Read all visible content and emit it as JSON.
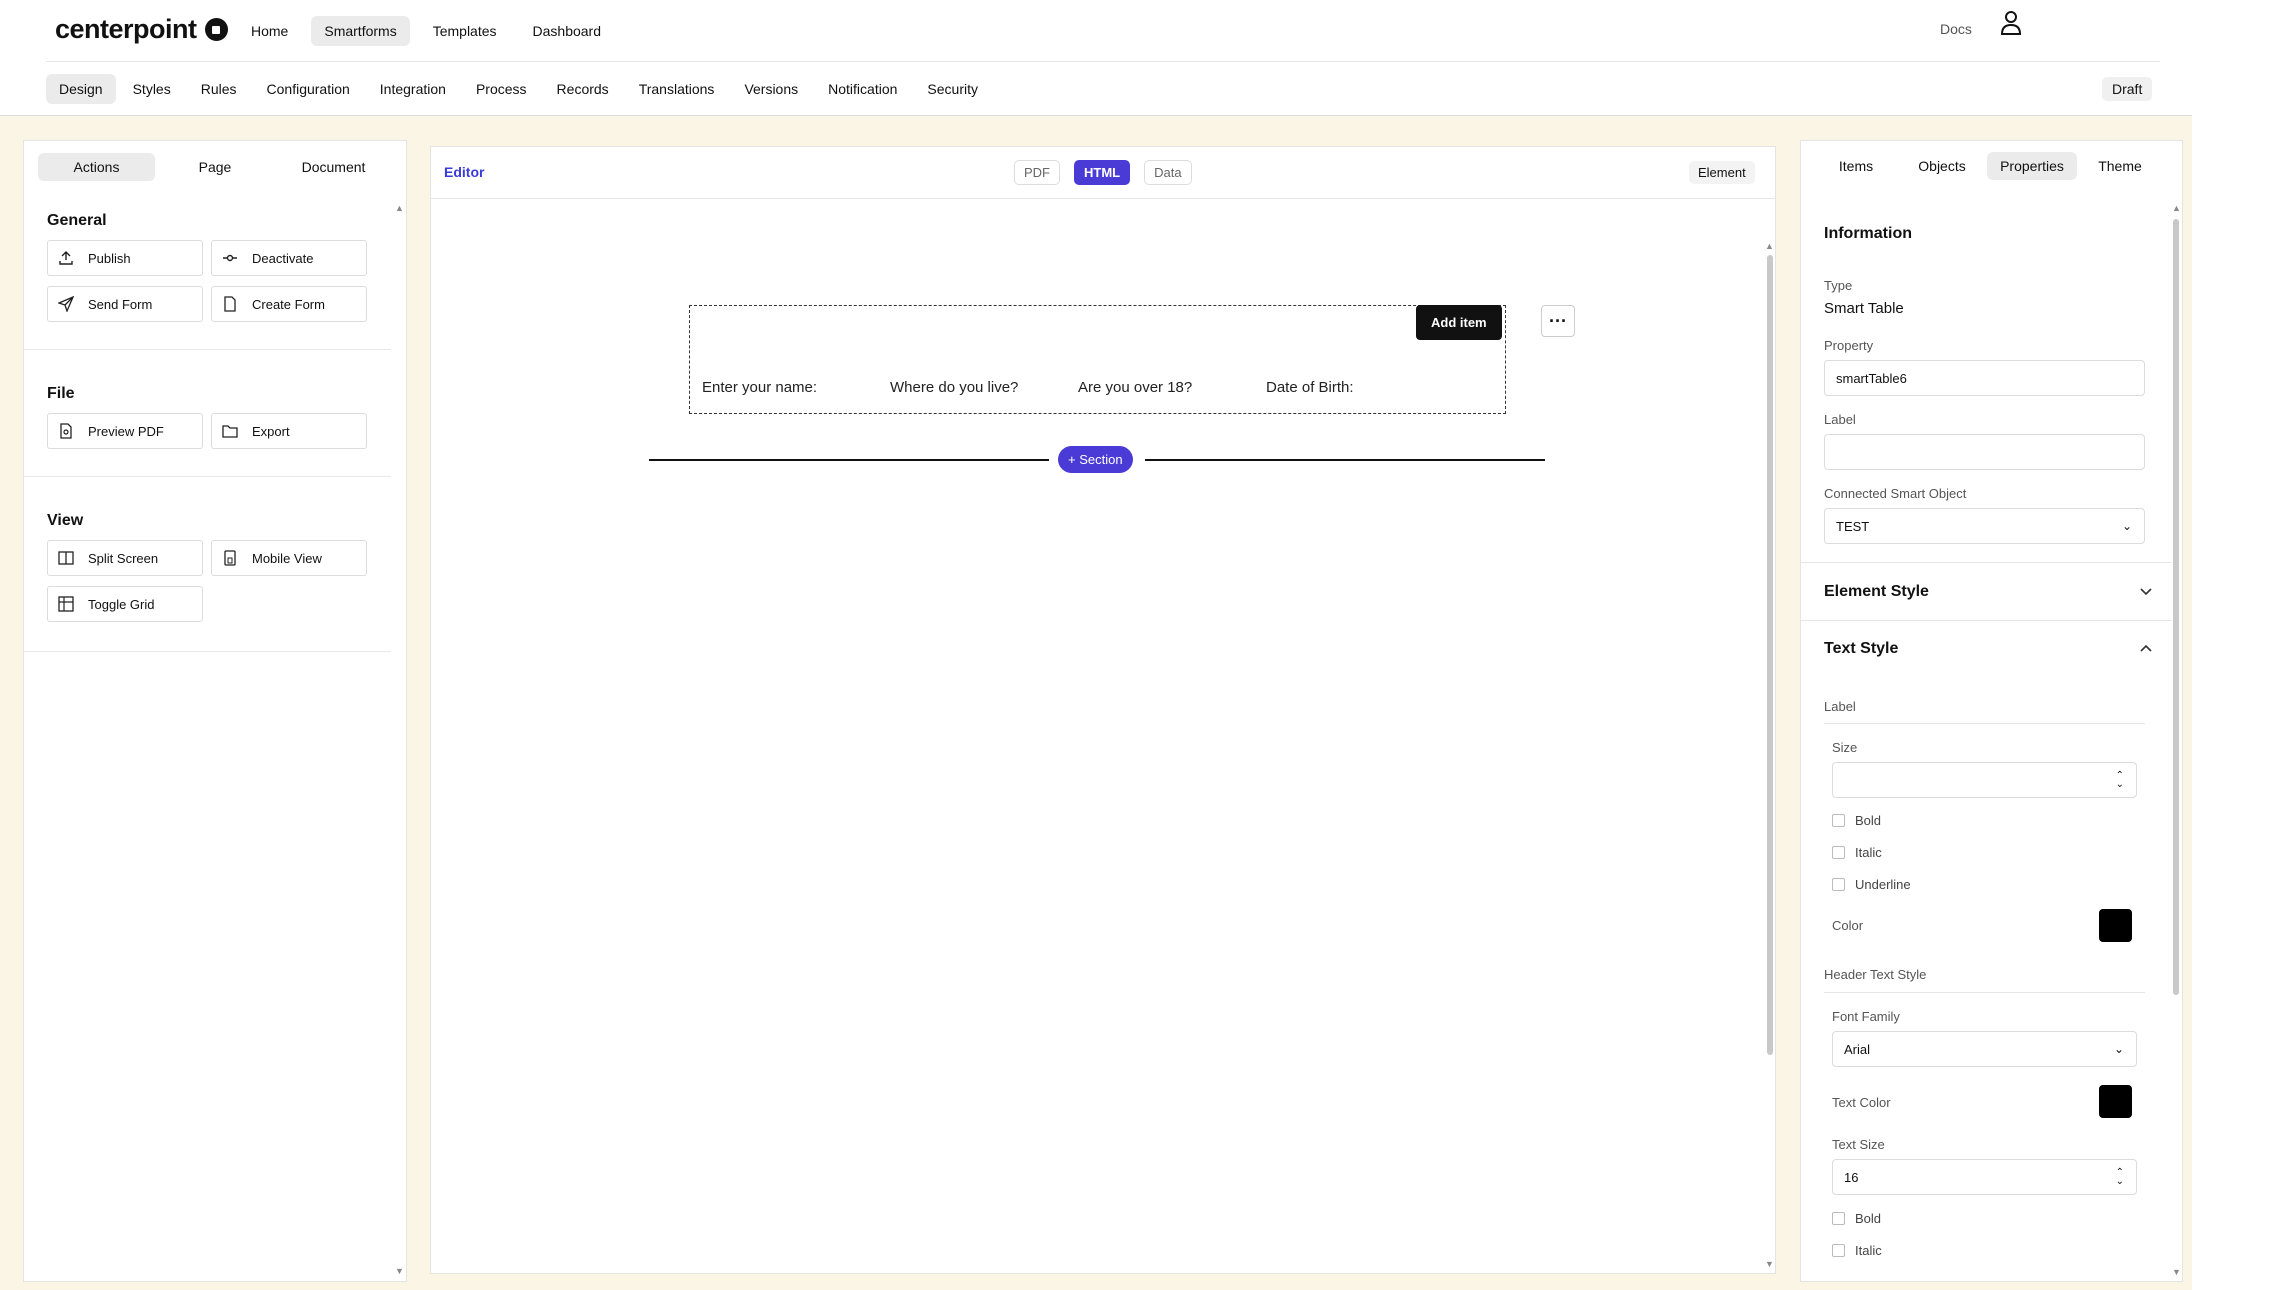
{
  "brand": "centerpoint",
  "mainnav": [
    "Home",
    "Smartforms",
    "Templates",
    "Dashboard"
  ],
  "docs": "Docs",
  "subnav": [
    "Design",
    "Styles",
    "Rules",
    "Configuration",
    "Integration",
    "Process",
    "Records",
    "Translations",
    "Versions",
    "Notification",
    "Security"
  ],
  "status": "Draft",
  "left": {
    "tabs": [
      "Actions",
      "Page",
      "Document"
    ],
    "general": {
      "title": "General",
      "buttons": [
        "Publish",
        "Deactivate",
        "Send Form",
        "Create Form"
      ]
    },
    "file": {
      "title": "File",
      "buttons": [
        "Preview PDF",
        "Export"
      ]
    },
    "view": {
      "title": "View",
      "buttons": [
        "Split Screen",
        "Mobile View",
        "Toggle Grid"
      ]
    }
  },
  "editor": {
    "label": "Editor",
    "modes": [
      "PDF",
      "HTML",
      "Data"
    ],
    "element": "Element",
    "add_item": "Add item",
    "columns": [
      "Enter your name:",
      "Where do you live?",
      "Are you over 18?",
      "Date of Birth:"
    ],
    "section": "+ Section"
  },
  "right": {
    "tabs": [
      "Items",
      "Objects",
      "Properties",
      "Theme"
    ],
    "info_title": "Information",
    "type_label": "Type",
    "type_value": "Smart Table",
    "property_label": "Property",
    "property_value": "smartTable6",
    "label_label": "Label",
    "label_value": "",
    "connected_label": "Connected Smart Object",
    "connected_value": "TEST",
    "element_style": "Element Style",
    "text_style": "Text Style",
    "ts_label": "Label",
    "size_label": "Size",
    "bold": "Bold",
    "italic": "Italic",
    "underline": "Underline",
    "color": "Color",
    "header_text_style": "Header Text Style",
    "font_family_label": "Font Family",
    "font_family_value": "Arial",
    "text_color": "Text Color",
    "text_size_label": "Text Size",
    "text_size_value": "16",
    "bold2": "Bold",
    "italic2": "Italic"
  }
}
